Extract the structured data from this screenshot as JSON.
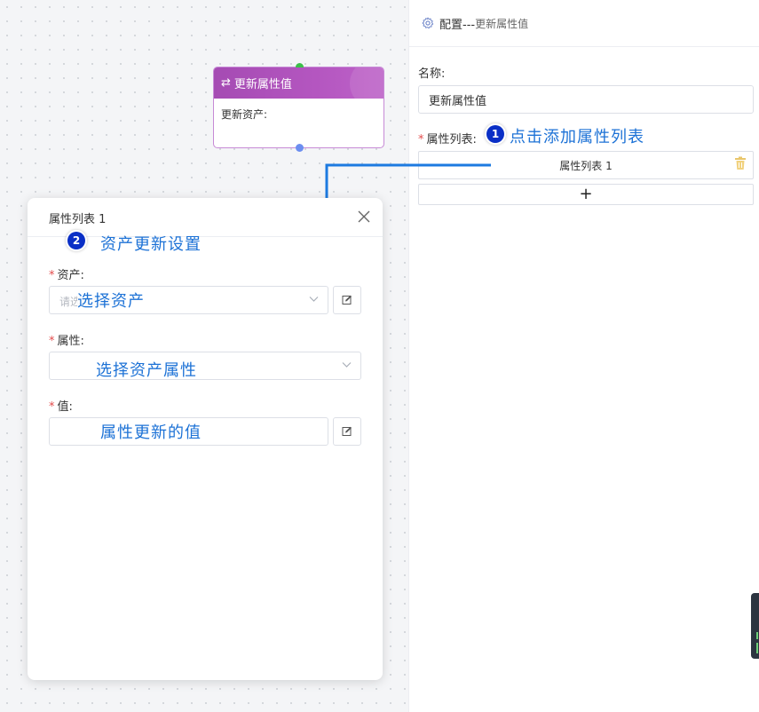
{
  "canvas": {
    "node": {
      "title": "更新属性值",
      "body_text": "更新资产:",
      "icon": "swap-arrows-icon",
      "header_color": "#b157bd",
      "port_top_color": "#3cbf4a",
      "port_bottom_color": "#6c8ef0"
    }
  },
  "config_panel": {
    "header_title": "配置---",
    "header_subtitle": "更新属性值",
    "header_icon": "gear-icon",
    "name_label": "名称:",
    "name_value": "更新属性值",
    "attr_list_label": "属性列表:",
    "attr_list_items": [
      "属性列表 1"
    ],
    "add_button_label": "+",
    "delete_icon": "trash-icon"
  },
  "dialog": {
    "title": "属性列表 1",
    "asset_label": "资产:",
    "asset_placeholder": "请选择资产",
    "property_label": "属性:",
    "value_label": "值:"
  },
  "annotations": {
    "step1_number": "1",
    "step1_text": "点击添加属性列表",
    "step2_number": "2",
    "step2_text": "资产更新设置",
    "asset_hint": "选择资产",
    "property_hint": "选择资产属性",
    "value_hint": "属性更新的值",
    "color": "#1d72d6",
    "badge_color": "#0a2fc6"
  }
}
